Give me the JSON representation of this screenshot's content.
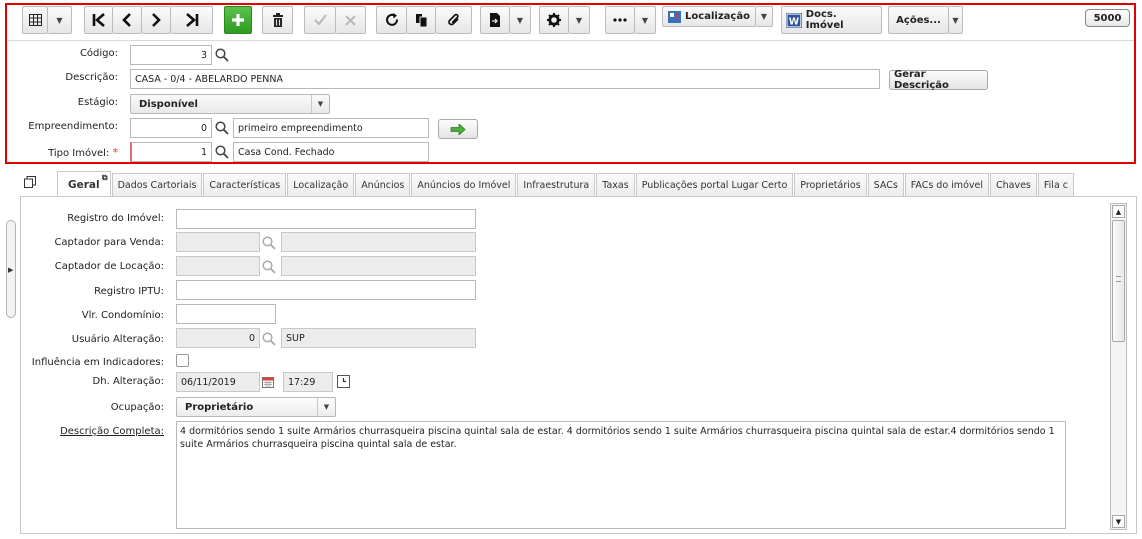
{
  "toolbar": {
    "localizacao_label": "Localização",
    "docs_label": "Docs. Imóvel",
    "acoes_label": "Ações...",
    "counter": "5000"
  },
  "form": {
    "codigo_label": "Código:",
    "codigo_value": "3",
    "descricao_label": "Descrição:",
    "descricao_value": "CASA - 0/4  - ABELARDO PENNA",
    "gerar_label": "Gerar Descrição",
    "estagio_label": "Estágio:",
    "estagio_value": "Disponível",
    "empreendimento_label": "Empreendimento:",
    "empreendimento_code": "0",
    "empreendimento_name": "primeiro empreendimento",
    "tipo_label": "Tipo Imóvel:",
    "tipo_required": "*",
    "tipo_code": "1",
    "tipo_name": "Casa Cond. Fechado"
  },
  "tabs": [
    "Geral",
    "Dados Cartoriais",
    "Características",
    "Localização",
    "Anúncios",
    "Anúncios do Imóvel",
    "Infraestrutura",
    "Taxas",
    "Publicações portal Lugar Certo",
    "Proprietários",
    "SACs",
    "FACs do imóvel",
    "Chaves",
    "Fila c"
  ],
  "active_tab": "Geral",
  "geral": {
    "registro_label": "Registro do Imóvel:",
    "captador_venda_label": "Captador para Venda:",
    "captador_locacao_label": "Captador de Locação:",
    "iptu_label": "Registro IPTU:",
    "condominio_label": "Vlr. Condomínio:",
    "usuario_label": "Usuário Alteração:",
    "usuario_code": "0",
    "usuario_name": "SUP",
    "influencia_label": "Influência em Indicadores:",
    "dh_label": "Dh. Alteração:",
    "dh_date": "06/11/2019",
    "dh_time": "17:29",
    "ocupacao_label": "Ocupação:",
    "ocupacao_value": "Proprietário",
    "descricao_completa_label": "Descrição Completa:",
    "descricao_completa_value": "4 dormitórios sendo 1 suite Armários  churrasqueira piscina quintal sala de estar. 4 dormitórios sendo 1 suite Armários  churrasqueira piscina quintal sala de estar.4 dormitórios sendo 1 suite Armários  churrasqueira piscina quintal sala de estar."
  },
  "colors": {
    "highlight": "#e00000",
    "add_button": "#2f9a22",
    "required": "#d33333"
  }
}
